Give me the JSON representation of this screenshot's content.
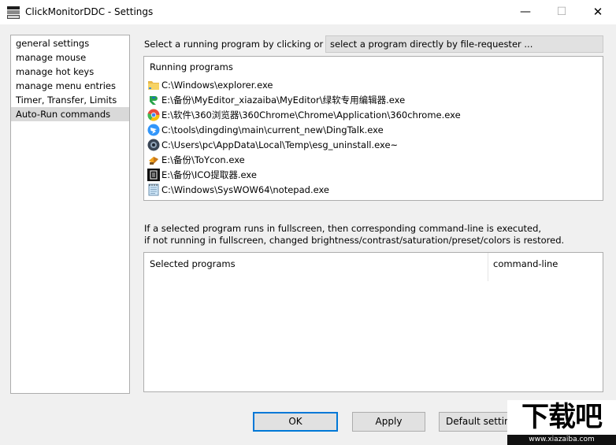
{
  "window": {
    "title": "ClickMonitorDDC - Settings",
    "minimize_glyph": "—",
    "maximize_glyph": "☐",
    "close_glyph": "✕"
  },
  "nav": {
    "items": [
      {
        "label": "general settings"
      },
      {
        "label": "manage mouse"
      },
      {
        "label": "manage hot keys"
      },
      {
        "label": "manage menu entries"
      },
      {
        "label": "Timer, Transfer, Limits"
      },
      {
        "label": "Auto-Run commands",
        "selected": true
      }
    ]
  },
  "select": {
    "label": "Select a running program by clicking or",
    "file_requester_label": "select a program directly by file-requester ..."
  },
  "running": {
    "header": "Running programs",
    "programs": [
      {
        "icon": "folder-icon",
        "path": "C:\\Windows\\explorer.exe"
      },
      {
        "icon": "myeditor-icon",
        "path": "E:\\备份\\MyEditor_xiazaiba\\MyEditor\\绿软专用编辑器.exe"
      },
      {
        "icon": "chrome-360-icon",
        "path": "E:\\软件\\360浏览器\\360Chrome\\Chrome\\Application\\360chrome.exe"
      },
      {
        "icon": "dingtalk-icon",
        "path": "C:\\tools\\dingding\\main\\current_new\\DingTalk.exe"
      },
      {
        "icon": "uninstall-icon",
        "path": "C:\\Users\\pc\\AppData\\Local\\Temp\\esg_uninstall.exe~"
      },
      {
        "icon": "toycon-icon",
        "path": "E:\\备份\\ToYcon.exe"
      },
      {
        "icon": "ico-extractor-icon",
        "path": "E:\\备份\\ICO提取器.exe"
      },
      {
        "icon": "notepad-icon",
        "path": "C:\\Windows\\SysWOW64\\notepad.exe"
      }
    ]
  },
  "info": {
    "line1": "If a selected program runs in fullscreen, then corresponding command-line is executed,",
    "line2": "if not running in fullscreen, changed brightness/contrast/saturation/preset/colors is restored."
  },
  "selected": {
    "col1": "Selected programs",
    "col2": "command-line"
  },
  "buttons": {
    "ok": "OK",
    "apply": "Apply",
    "defaults": "Default settings"
  },
  "watermark": {
    "main": "下载吧",
    "sub": "www.xiazaiba.com"
  },
  "colors": {
    "accent": "#0078d7",
    "selection": "#d9d9d9"
  }
}
